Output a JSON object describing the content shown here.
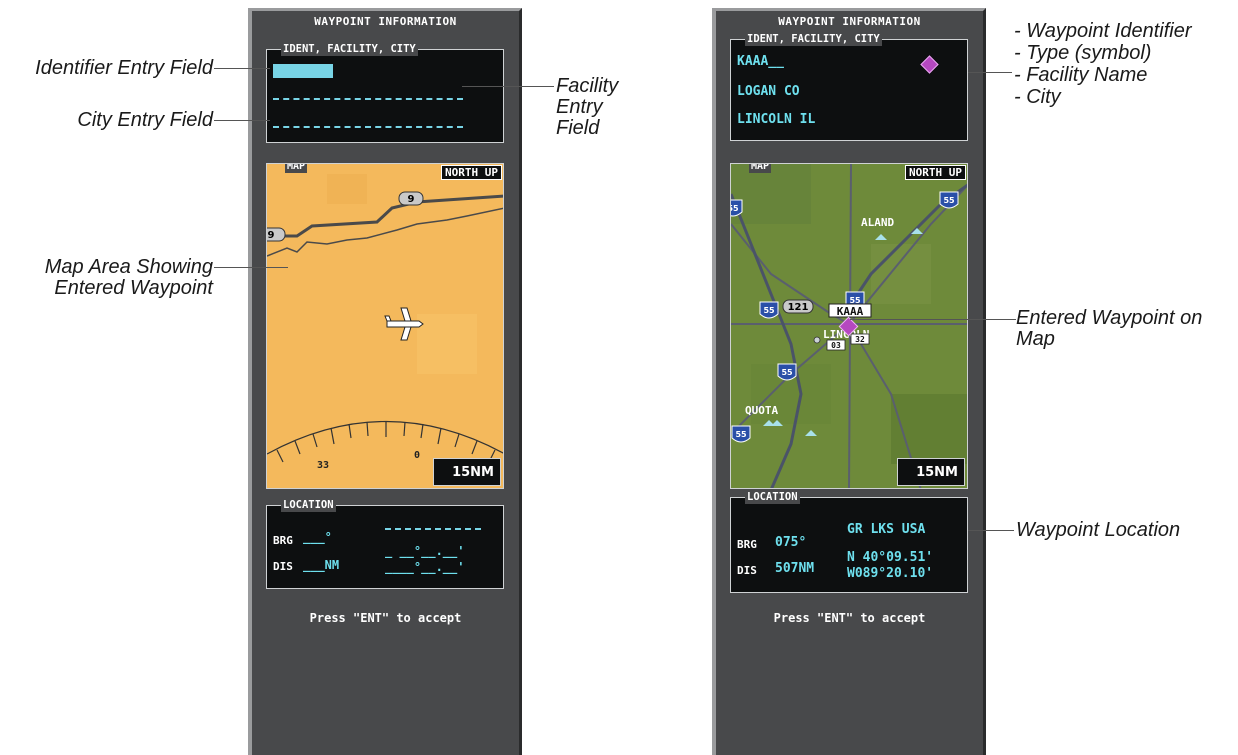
{
  "left_panel": {
    "title": "WAYPOINT INFORMATION",
    "ident_box_label": "IDENT, FACILITY, CITY",
    "map_label": "MAP",
    "north_up": "NORTH UP",
    "route_markers": [
      "9",
      "9"
    ],
    "compass_numbers": [
      "33",
      "0"
    ],
    "range": "15NM",
    "location_label": "LOCATION",
    "brg_label": "BRG",
    "brg_value": "___°",
    "dis_label": "DIS",
    "dis_value": "___NM",
    "lat_value": "_ __°__.__'",
    "lon_value": "____°__.__'",
    "press_text": "Press \"ENT\" to accept"
  },
  "right_panel": {
    "title": "WAYPOINT INFORMATION",
    "ident_box_label": "IDENT, FACILITY, CITY",
    "ident_value": "KAAA__",
    "facility_value": "LOGAN CO",
    "city_value": "LINCOLN IL",
    "map_label": "MAP",
    "north_up": "NORTH UP",
    "map_labels": [
      "ALAND",
      "KAAA",
      "LINCOLN",
      "03",
      "32",
      "QUOTA",
      "121"
    ],
    "interstate_shields": [
      "55",
      "55",
      "55",
      "55",
      "55",
      "55"
    ],
    "range": "15NM",
    "location_label": "LOCATION",
    "brg_label": "BRG",
    "brg_value": "075°",
    "dis_label": "DIS",
    "dis_value": "507NM",
    "region_value": "GR LKS USA",
    "lat_value": "N 40°09.51'",
    "lon_value": "W089°20.10'",
    "press_text": "Press \"ENT\" to accept"
  },
  "callouts": {
    "identifier_entry": "Identifier Entry Field",
    "city_entry": "City Entry Field",
    "facility_entry": [
      "Facility",
      "Entry",
      "Field"
    ],
    "map_area": [
      "Map Area Showing",
      "Entered Waypoint"
    ],
    "waypoint_info": [
      "- Waypoint Identifier",
      "- Type (symbol)",
      "- Facility Name",
      "- City"
    ],
    "entered_waypoint": [
      "Entered Waypoint on",
      "Map"
    ],
    "waypoint_location": "Waypoint Location"
  },
  "colors": {
    "bezel": "#48494b",
    "display_text_cyan": "#6ee0ee",
    "map_land_tan": "#f4b95c",
    "map_land_green": "#6e8a3a",
    "waypoint_symbol": "#b548c0"
  }
}
